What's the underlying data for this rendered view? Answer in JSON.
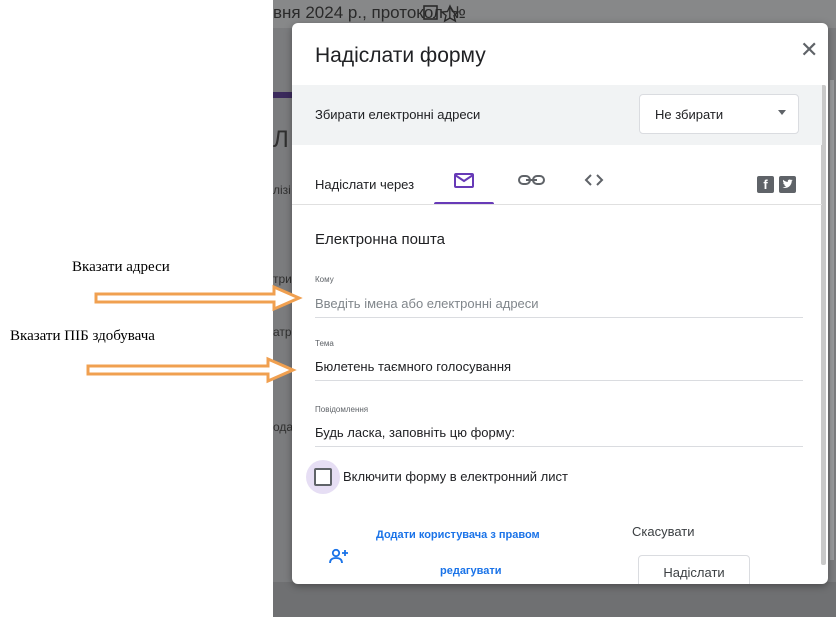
{
  "background": {
    "title_fragment": "вня 2024 р., протокол №",
    "side_fragments": [
      "Л",
      "лізі",
      "три",
      "атр",
      "ода"
    ]
  },
  "dialog": {
    "title": "Надіслати форму",
    "close_glyph": "✕",
    "collect_emails": {
      "label": "Збирати електронні адреси",
      "selected": "Не збирати"
    },
    "send_via": {
      "label": "Надіслати через",
      "tabs": [
        {
          "name": "email",
          "icon": "envelope-icon",
          "active": true
        },
        {
          "name": "link",
          "icon": "link-icon",
          "active": false
        },
        {
          "name": "embed",
          "icon": "code-icon",
          "active": false
        }
      ],
      "social": {
        "facebook": "f",
        "twitter": "twitter-icon"
      }
    },
    "email_section": {
      "title": "Електронна пошта",
      "to": {
        "label": "Кому",
        "placeholder": "Введіть імена або електронні адреси"
      },
      "subject": {
        "label": "Тема",
        "value": "Бюлетень таємного голосування"
      },
      "message": {
        "label": "Повідомлення",
        "value": "Будь ласка, заповніть цю форму:"
      },
      "include_form": {
        "label": "Включити форму в електронний лист",
        "checked": false
      }
    },
    "footer": {
      "add_collaborator_line1": "Додати користувача з правом",
      "add_collaborator_line2": "редагувати",
      "cancel": "Скасувати",
      "send": "Надіслати"
    }
  },
  "annotations": {
    "specify_addresses": "Вказати адреси",
    "specify_name": "Вказати ПІБ здобувача",
    "arrow_color": "#f0a050"
  }
}
